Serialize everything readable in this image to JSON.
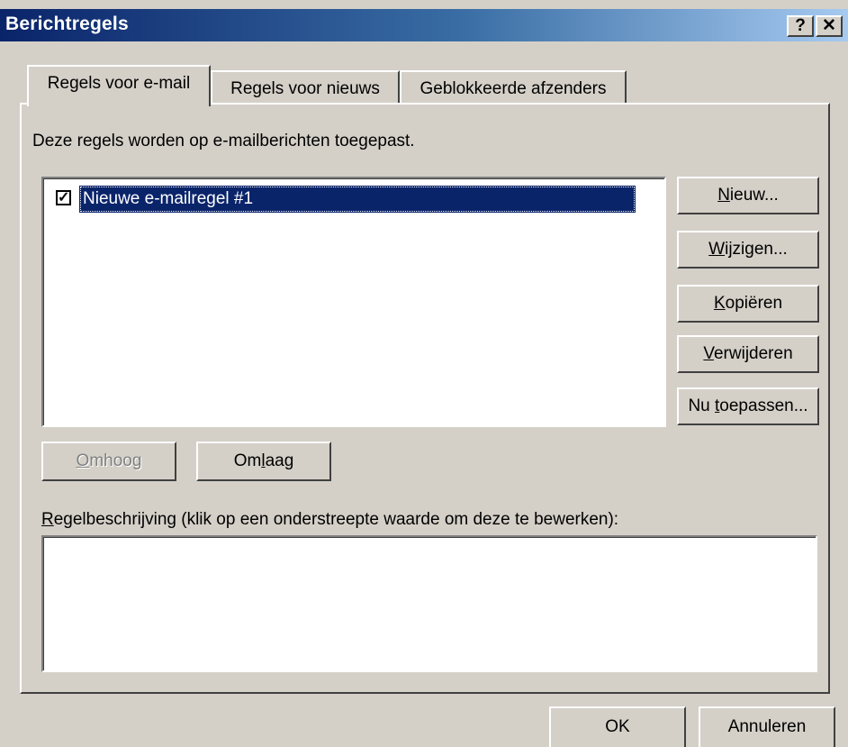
{
  "window": {
    "title": "Berichtregels",
    "help_glyph": "?",
    "close_glyph": "✕"
  },
  "tabs": [
    {
      "label": "Regels voor e-mail",
      "active": true
    },
    {
      "label": "Regels voor nieuws",
      "active": false
    },
    {
      "label": "Geblokkeerde afzenders",
      "active": false
    }
  ],
  "panel": {
    "description": "Deze regels worden op e-mailberichten toegepast."
  },
  "rules": [
    {
      "name": "Nieuwe e-mailregel #1",
      "checked": true,
      "check_glyph": "✓"
    }
  ],
  "side_buttons": [
    {
      "pre": "",
      "mnemonic": "N",
      "post": "ieuw..."
    },
    {
      "pre": "",
      "mnemonic": "W",
      "post": "ijzigen..."
    },
    {
      "pre": "",
      "mnemonic": "K",
      "post": "opiëren"
    },
    {
      "pre": "",
      "mnemonic": "V",
      "post": "erwijderen"
    },
    {
      "pre": "Nu ",
      "mnemonic": "t",
      "post": "oepassen..."
    }
  ],
  "order_buttons": {
    "up": {
      "pre": "",
      "mnemonic": "O",
      "post": "mhoog",
      "disabled": true
    },
    "down": {
      "pre": "Om",
      "mnemonic": "l",
      "post": "aag",
      "disabled": false
    }
  },
  "rule_description": {
    "label_mnemonic": "R",
    "label_rest": "egelbeschrijving (klik op een onderstreepte waarde om deze te bewerken):",
    "content": ""
  },
  "dialog_buttons": {
    "ok": "OK",
    "cancel": "Annuleren"
  }
}
